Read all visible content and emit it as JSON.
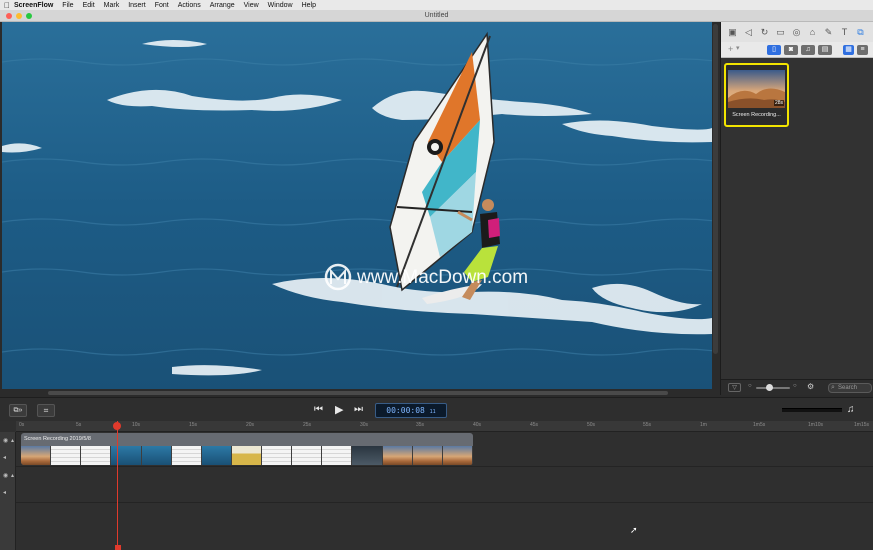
{
  "menubar": {
    "apple": "",
    "app_name": "ScreenFlow",
    "items": [
      "File",
      "Edit",
      "Mark",
      "Insert",
      "Font",
      "Actions",
      "Arrange",
      "View",
      "Window",
      "Help"
    ]
  },
  "window": {
    "title": "Untitled",
    "colors": {
      "close": "#fe5f57",
      "minimize": "#febc2e",
      "zoom": "#28c840"
    }
  },
  "canvas": {
    "watermark": "www.MacDown.com",
    "colors": {
      "sea": "#1f5d86",
      "sail_orange": "#e0762a",
      "sail_cyan": "#41b6c9",
      "wetsuit_lime": "#b9e23b"
    }
  },
  "inspector": {
    "icons": [
      "video-properties-icon",
      "audio-properties-icon",
      "video-motion-icon",
      "screen-recording-icon",
      "callout-icon",
      "touch-callout-icon",
      "annotations-icon",
      "text-icon",
      "media-library-icon"
    ],
    "glyphs": [
      "▣",
      "◁",
      "↻",
      "▭",
      "◎",
      "⌂",
      "✎",
      "T",
      "⧉"
    ],
    "active_index": 8
  },
  "library": {
    "add_label": "+",
    "media_item": {
      "name": "Screen Recording...",
      "duration": "28s"
    },
    "search_placeholder": "Search"
  },
  "transport": {
    "timecode_main": "00:00:08",
    "timecode_frames": "11",
    "rewind": "⏮",
    "play": "▶",
    "forward": "⏭",
    "headphones": "♫"
  },
  "timeline": {
    "ruler_labels": [
      "0s",
      "5s",
      "10s",
      "15s",
      "20s",
      "25s",
      "30s",
      "35s",
      "40s",
      "45s",
      "50s",
      "55s",
      "1m",
      "1m5s",
      "1m10s",
      "1m15s"
    ],
    "clip_name": "Screen Recording 2019/5/8",
    "clip_frames": [
      "desert",
      "white",
      "white",
      "sea",
      "sea",
      "white",
      "sea",
      "yellow",
      "white",
      "white",
      "white",
      "dark",
      "desert",
      "desert",
      "desert"
    ]
  }
}
